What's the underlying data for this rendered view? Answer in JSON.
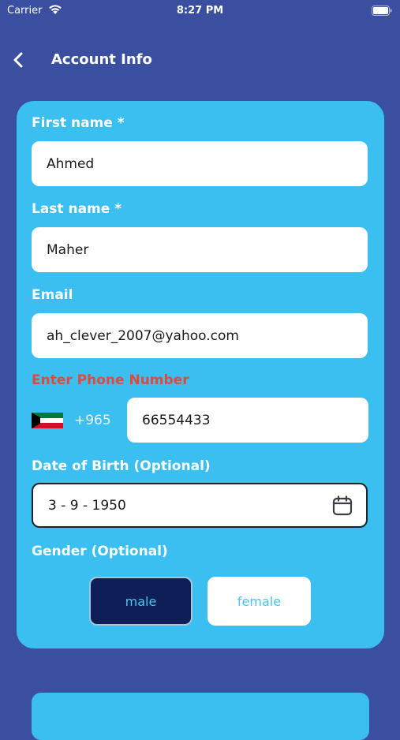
{
  "status_bar": {
    "carrier": "Carrier",
    "time": "8:27 PM"
  },
  "header": {
    "title": "Account Info",
    "back_icon": "chevron-left-icon"
  },
  "form": {
    "first_name": {
      "label": "First name *",
      "value": "Ahmed"
    },
    "last_name": {
      "label": "Last name *",
      "value": "Maher"
    },
    "email": {
      "label": "Email",
      "value": "ah_clever_2007@yahoo.com"
    },
    "phone": {
      "label": "Enter Phone Number",
      "flag_icon": "kuwait-flag-icon",
      "dial_code": "+965",
      "value": "66554433"
    },
    "dob": {
      "label": "Date of Birth (Optional)",
      "value": "3 - 9 - 1950",
      "icon": "calendar-icon"
    },
    "gender": {
      "label": "Gender (Optional)",
      "options": [
        {
          "label": "male",
          "selected": true
        },
        {
          "label": "female",
          "selected": false
        }
      ]
    }
  },
  "colors": {
    "background": "#3b4fa0",
    "card": "#3bbff0",
    "alert_label": "#e2493b",
    "selected_gender": "#101e57"
  }
}
